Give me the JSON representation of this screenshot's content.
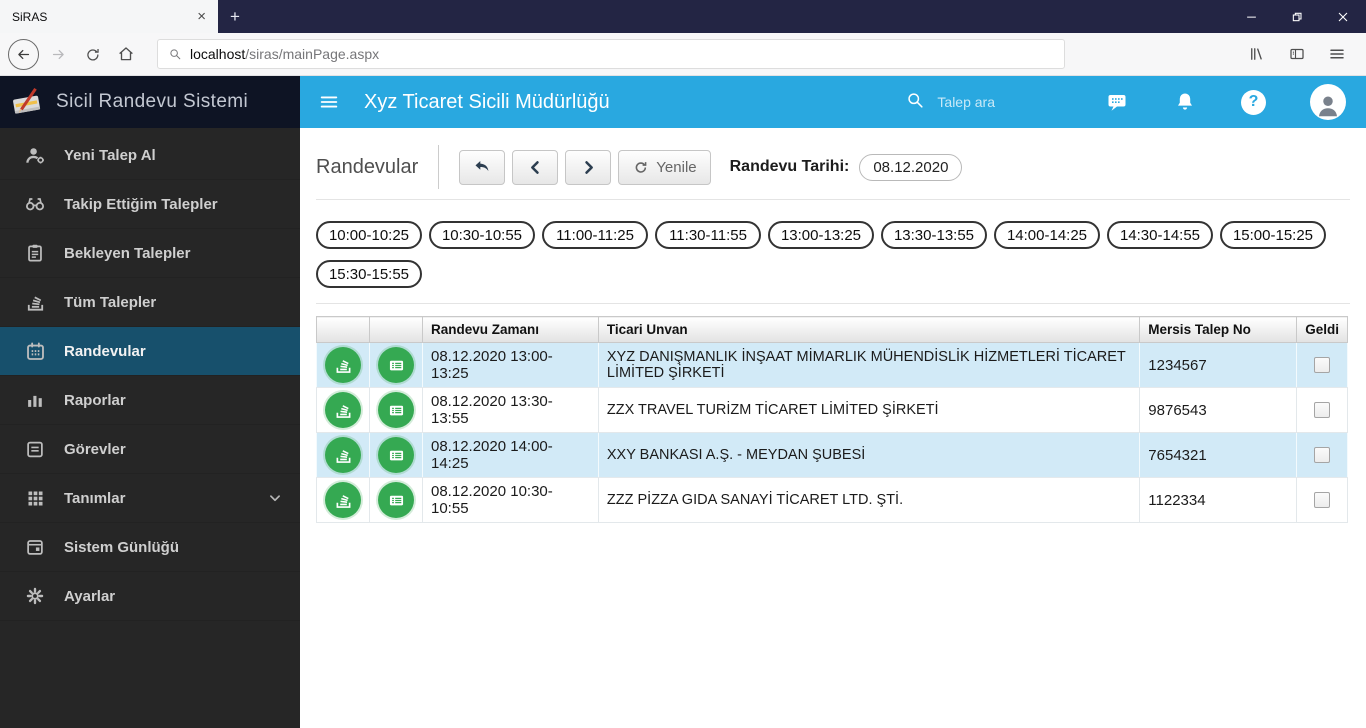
{
  "colors": {
    "accent_blue": "#29a8e0",
    "titlebar_bg": "#232544",
    "sidebar_bg": "#262626",
    "sidebar_header_bg": "#0e1424",
    "active_item_bg": "#17506c",
    "row_alt_blue": "#d2eaf7",
    "action_green": "#35a952"
  },
  "icons": {
    "close": "×",
    "plus": "+",
    "question": "?"
  },
  "browser": {
    "tab_title": "SiRAS",
    "url_host": "localhost",
    "url_path": "/siras/mainPage.aspx"
  },
  "sidebar": {
    "brand": "Sicil Randevu Sistemi",
    "items": [
      {
        "label": "Yeni Talep Al"
      },
      {
        "label": "Takip Ettiğim Talepler"
      },
      {
        "label": "Bekleyen Talepler"
      },
      {
        "label": "Tüm Talepler"
      },
      {
        "label": "Randevular"
      },
      {
        "label": "Raporlar"
      },
      {
        "label": "Görevler"
      },
      {
        "label": "Tanımlar"
      },
      {
        "label": "Sistem Günlüğü"
      },
      {
        "label": "Ayarlar"
      }
    ]
  },
  "header": {
    "title": "Xyz Ticaret Sicili Müdürlüğü",
    "search_placeholder": "Talep ara"
  },
  "toolbar": {
    "page_title": "Randevular",
    "refresh_label": "Yenile",
    "date_label": "Randevu Tarihi:",
    "date_value": "08.12.2020"
  },
  "time_slots": [
    "10:00-10:25",
    "10:30-10:55",
    "11:00-11:25",
    "11:30-11:55",
    "13:00-13:25",
    "13:30-13:55",
    "14:00-14:25",
    "14:30-14:55",
    "15:00-15:25",
    "15:30-15:55"
  ],
  "table": {
    "headers": [
      "",
      "",
      "Randevu Zamanı",
      "Ticari Unvan",
      "Mersis Talep No",
      "Geldi"
    ],
    "rows": [
      {
        "time": "08.12.2020 13:00-13:25",
        "company": "XYZ DANIŞMANLIK İNŞAAT MİMARLIK MÜHENDİSLİK HİZMETLERİ TİCARET LİMİTED ŞİRKETİ",
        "mersis": "1234567",
        "geldi": false
      },
      {
        "time": "08.12.2020 13:30-13:55",
        "company": "ZZX TRAVEL TURİZM TİCARET LİMİTED ŞİRKETİ",
        "mersis": "9876543",
        "geldi": false
      },
      {
        "time": "08.12.2020 14:00-14:25",
        "company": "XXY BANKASI A.Ş. - MEYDAN ŞUBESİ",
        "mersis": "7654321",
        "geldi": false
      },
      {
        "time": "08.12.2020 10:30-10:55",
        "company": "ZZZ PİZZA GIDA SANAYİ TİCARET LTD. ŞTİ.",
        "mersis": "1122334",
        "geldi": false
      }
    ]
  }
}
